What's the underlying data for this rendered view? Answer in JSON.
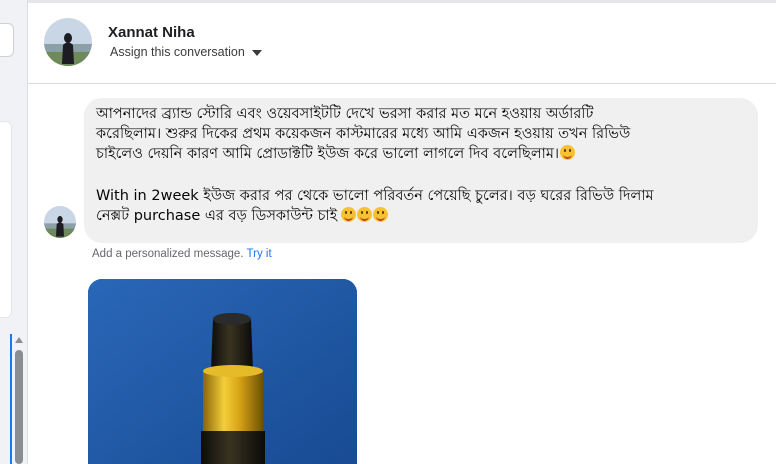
{
  "conversation": {
    "contact_name": "Xannat Niha",
    "assign_label": "Assign this conversation"
  },
  "message": {
    "lines_1": [
      "আপনাদের ব্র্যান্ড স্টোরি এবং ওয়েবসাইটটি দেখে ভরসা করার মত মনে হওয়ায় অর্ডারটি",
      "করেছিলাম। শুরুর দিকের প্রথম কয়েকজন কাস্টমারের মধ্যে আমি একজন হওয়ায় তখন রিভিউ",
      "চাইলেও দেয়নি কারণ আমি প্রোডাক্টটি ইউজ করে ভালো লাগলে দিব বলেছিলাম।"
    ],
    "lines_2": [
      "With in 2week ইউজ করার পর থেকে ভালো পরিবর্তন পেয়েছি চুলের। বড় ঘরের রিভিউ দিলাম",
      "নেক্সট purchase এর বড় ডিসকাউন্ট চাই"
    ],
    "emoji_name": "grinning-face"
  },
  "hint": {
    "text": "Add a personalized message.",
    "link": "Try it"
  },
  "attachment": {
    "type": "photo",
    "subject": "product dropper bottle"
  },
  "colors": {
    "bubble": "#f0f0f0",
    "link": "#1877f2",
    "photo_bg": "#1f5aa8",
    "cap_gold": "#d9a514"
  }
}
